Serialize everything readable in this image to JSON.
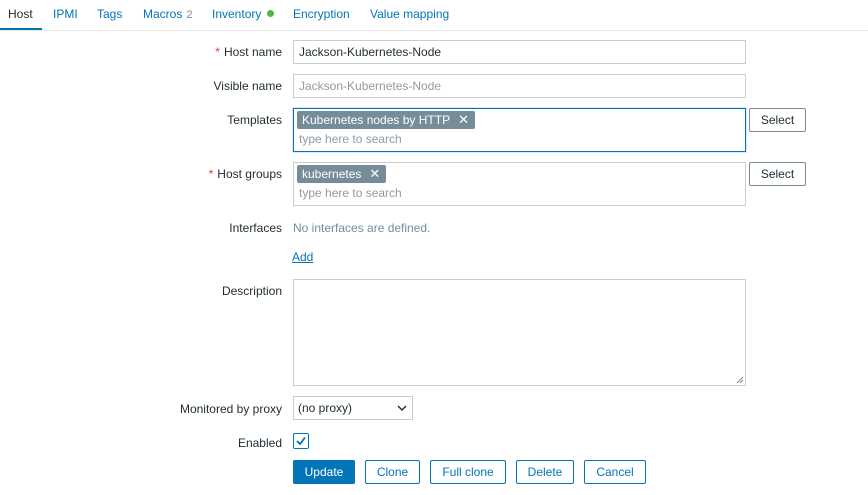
{
  "tabs": [
    {
      "label": "Host",
      "active": true
    },
    {
      "label": "IPMI"
    },
    {
      "label": "Tags"
    },
    {
      "label": "Macros",
      "count": "2"
    },
    {
      "label": "Inventory",
      "status_dot_color": "#59b14c"
    },
    {
      "label": "Encryption"
    },
    {
      "label": "Value mapping"
    }
  ],
  "form": {
    "host_name": {
      "label": "Host name",
      "required_mark": "*",
      "value": "Jackson-Kubernetes-Node"
    },
    "visible_name": {
      "label": "Visible name",
      "placeholder": "Jackson-Kubernetes-Node"
    },
    "templates": {
      "label": "Templates",
      "chips": [
        "Kubernetes nodes by HTTP"
      ],
      "search_placeholder": "type here to search",
      "select_label": "Select"
    },
    "host_groups": {
      "label": "Host groups",
      "required_mark": "*",
      "chips": [
        "kubernetes"
      ],
      "search_placeholder": "type here to search",
      "select_label": "Select"
    },
    "interfaces": {
      "label": "Interfaces",
      "empty_text": "No interfaces are defined.",
      "add_label": "Add"
    },
    "description": {
      "label": "Description",
      "value": ""
    },
    "proxy": {
      "label": "Monitored by proxy",
      "selected": "(no proxy)"
    },
    "enabled": {
      "label": "Enabled",
      "checked": true
    },
    "chip_remove_glyph": "✕"
  },
  "actions": {
    "update": "Update",
    "clone": "Clone",
    "full_clone": "Full clone",
    "delete": "Delete",
    "cancel": "Cancel"
  },
  "colors": {
    "accent": "#0275b8",
    "required": "#e33734",
    "chip_bg": "#768d99",
    "status_green": "#59b14c"
  }
}
